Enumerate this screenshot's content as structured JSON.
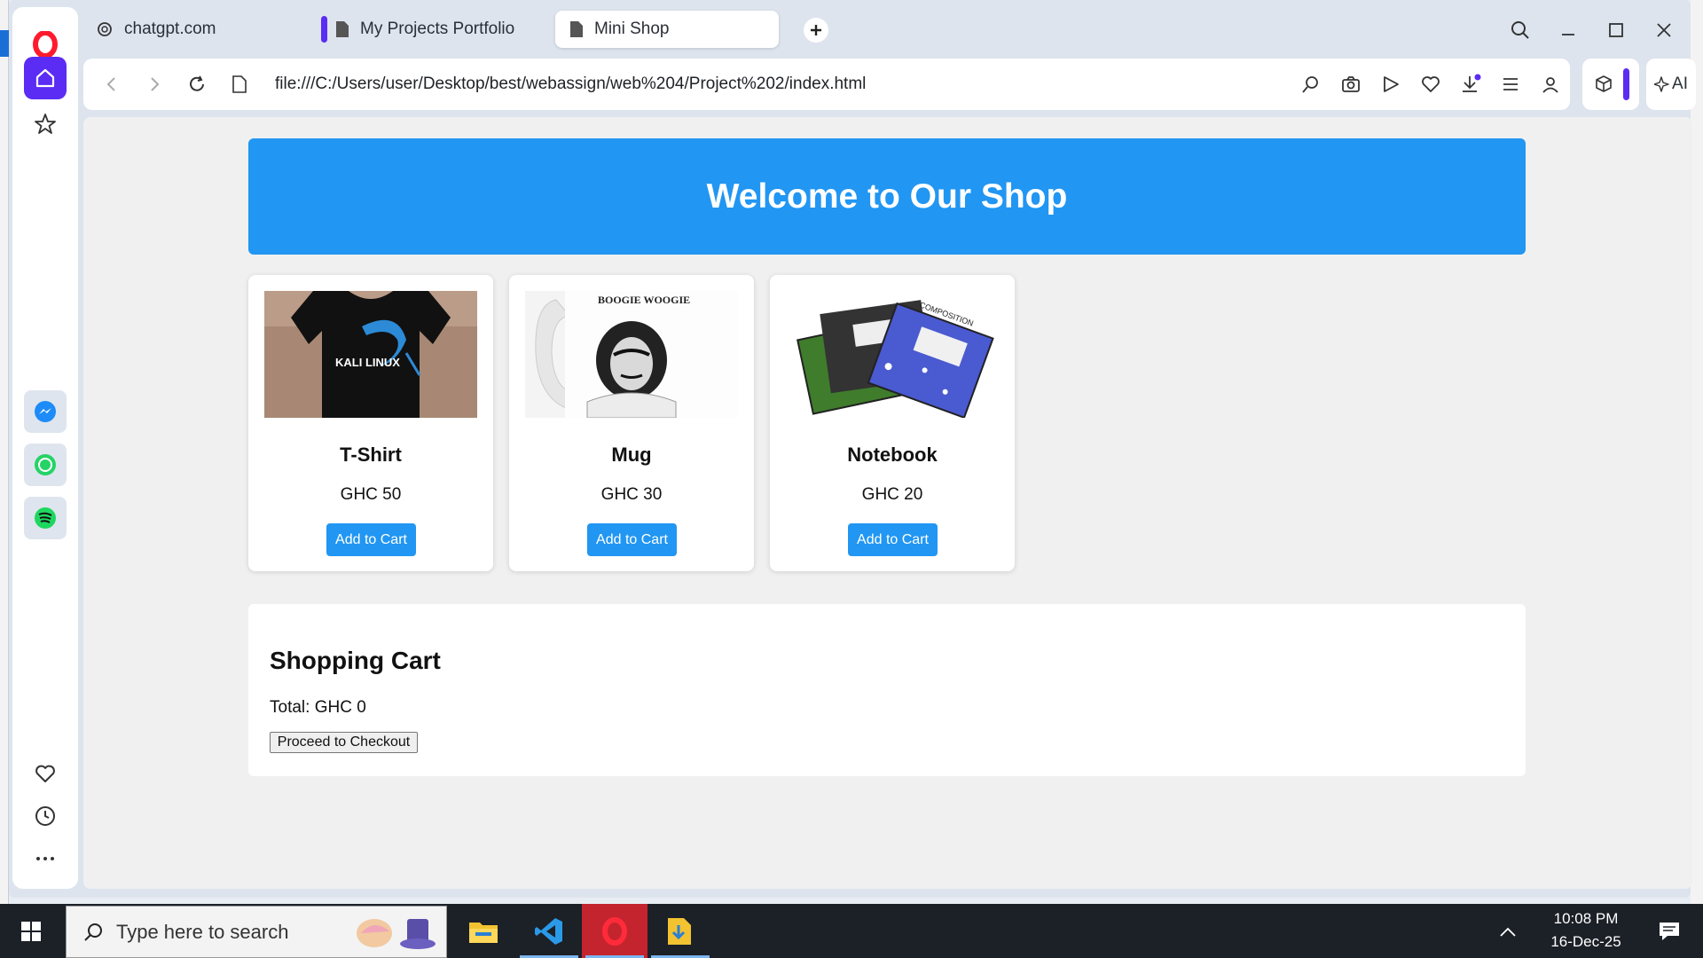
{
  "browser": {
    "tabs": [
      {
        "label": "chatgpt.com",
        "active": false
      },
      {
        "label": "My Projects Portfolio",
        "active": false
      },
      {
        "label": "Mini Shop",
        "active": true
      }
    ],
    "url": "file:///C:/Users/user/Desktop/best/webassign/web%204/Project%202/index.html",
    "ai_label": "AI",
    "accent_color": "#5b2cf3"
  },
  "page": {
    "header_title": "Welcome to Our Shop",
    "header_color": "#2196f3",
    "products": [
      {
        "name": "T-Shirt",
        "price": "GHC 50",
        "button": "Add to Cart",
        "image_caption": "KALI LINUX"
      },
      {
        "name": "Mug",
        "price": "GHC 30",
        "button": "Add to Cart",
        "image_caption": "BOOGIE WOOGIE"
      },
      {
        "name": "Notebook",
        "price": "GHC 20",
        "button": "Add to Cart",
        "image_caption": "COMPOSITION"
      }
    ],
    "cart": {
      "title": "Shopping Cart",
      "total": "Total: GHC 0",
      "checkout_button": "Proceed to Checkout"
    }
  },
  "taskbar": {
    "search_placeholder": "Type here to search",
    "time": "10:08 PM",
    "date": "16-Dec-25"
  }
}
